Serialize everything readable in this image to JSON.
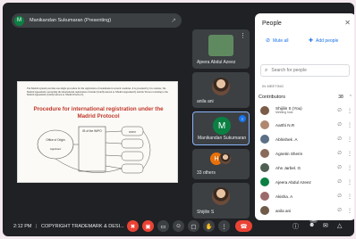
{
  "presenting": {
    "avatar_letter": "M",
    "label": "Manikandan Sukumaran (Presenting)"
  },
  "slide": {
    "body_text": "The Madrid system provides one single procedure for the registration of trademarks in several countries. It is governed by two treaties, 'the Madrid Agreement concerning the international registration of marks' (briefly known as 'Madrid Agreement') and the 'Protocol relating to the Madrid Agreement' (briefly known as 'Madrid Protocol').",
    "title": "Procedure for international registration under the Madrid Protocol",
    "diagram_labels": [
      "Office of Origin",
      "IB of the WIPO",
      "WIPO",
      "Applicant"
    ]
  },
  "tiles": [
    {
      "name": "Ajeera Abdul Azeez"
    },
    {
      "name": "anila ani"
    },
    {
      "name": "Manikandan Sukumaran",
      "avatar_letter": "M"
    },
    {
      "name": "33 others",
      "avatar_letter": "H"
    },
    {
      "name": "Shijilin S"
    }
  ],
  "bottombar": {
    "time": "2:12 PM",
    "meeting": "COPYRIGHT TRADEMARK & DESI...",
    "people_count": "38"
  },
  "people_panel": {
    "title": "People",
    "mute_all": "Mute all",
    "add_people": "Add people",
    "search_placeholder": "Search for people",
    "section": "IN MEETING",
    "contributors_label": "Contributors",
    "contributors_count": "38",
    "people": [
      {
        "name": "Shijilin S (You)",
        "sub": "Meeting host",
        "color": "#7a5c48"
      },
      {
        "name": "Aarthi N.R",
        "color": "#b08870"
      },
      {
        "name": "Abhishek .A",
        "color": "#5b6f86"
      },
      {
        "name": "Agnetin Sherin",
        "color": "#8a6b5a"
      },
      {
        "name": "Ahn Jarbel. G",
        "color": "#4f5f52"
      },
      {
        "name": "Ajeera Abdul Azeez",
        "color": "#0b8043"
      },
      {
        "name": "Akisha. A",
        "color": "#9c6a6a"
      },
      {
        "name": "anila ani",
        "color": "#6f5b48"
      }
    ]
  },
  "colors": {
    "background": "#202124",
    "accent": "#1a73e8",
    "end_call": "#ea4335",
    "active_tile_border": "#8ab4f8"
  }
}
